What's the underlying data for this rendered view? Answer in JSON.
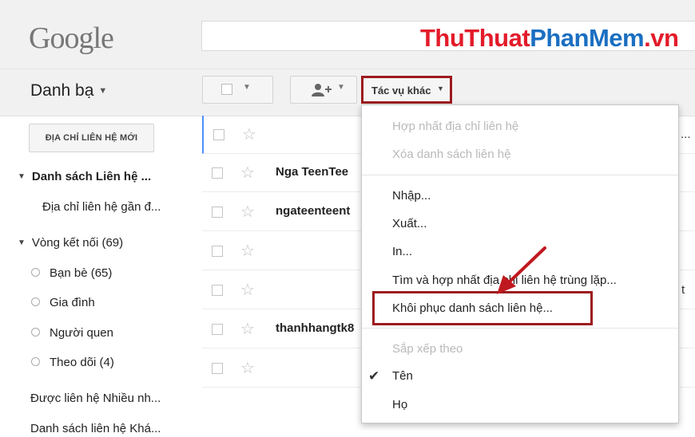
{
  "header": {
    "logo_text": "Google",
    "watermark": {
      "part1": "ThuThuat",
      "part2": "PhanMem",
      "part3": ".vn"
    }
  },
  "app": {
    "title": "Danh bạ"
  },
  "toolbar": {
    "more_actions_label": "Tác vụ khác"
  },
  "sidebar": {
    "new_contact_label": "ĐỊA CHỈ LIÊN HỆ MỚI",
    "contact_list_label": "Danh sách Liên hệ ...",
    "recent_contacts_label": "Địa chỉ liên hệ gần đ...",
    "circles_label": "Vòng kết nối (69)",
    "circles": [
      {
        "label": "Bạn bè (65)"
      },
      {
        "label": "Gia đình"
      },
      {
        "label": "Người quen"
      },
      {
        "label": "Theo dõi (4)"
      }
    ],
    "most_contacted_label": "Được liên hệ Nhiều nh...",
    "other_contacts_label": "Danh sách liên hệ Khá..."
  },
  "contacts": {
    "rows": [
      {
        "name": ""
      },
      {
        "name": "Nga TeenTee"
      },
      {
        "name": "ngateenteent"
      },
      {
        "name": ""
      },
      {
        "name": ""
      },
      {
        "name": "thanhhangtk8"
      },
      {
        "name": ""
      }
    ],
    "edge_text_1": "...",
    "edge_text_2": "t"
  },
  "menu": {
    "items": [
      {
        "label": "Hợp nhất địa chỉ liên hệ",
        "disabled": true
      },
      {
        "label": "Xóa danh sách liên hệ",
        "disabled": true
      },
      {
        "label": "Nhập...",
        "disabled": false
      },
      {
        "label": "Xuất...",
        "disabled": false
      },
      {
        "label": "In...",
        "disabled": false
      },
      {
        "label": "Tìm và hợp nhất địa chỉ liên hệ trùng lặp...",
        "disabled": false
      },
      {
        "label": "Khôi phục danh sách liên hệ...",
        "disabled": false
      }
    ],
    "sort_heading": "Sắp xếp theo",
    "sort_options": [
      {
        "label": "Tên",
        "checked": true
      },
      {
        "label": "Họ",
        "checked": false
      }
    ]
  },
  "colors": {
    "highlight": "#9c1b1f",
    "accent_blue": "#4d90fe",
    "watermark_red": "#e31b2a",
    "watermark_blue": "#1b6fc1"
  },
  "icons": [
    "chevron-down-icon",
    "add-contact-icon",
    "star-icon",
    "check-icon",
    "arrow-annotation-icon"
  ]
}
